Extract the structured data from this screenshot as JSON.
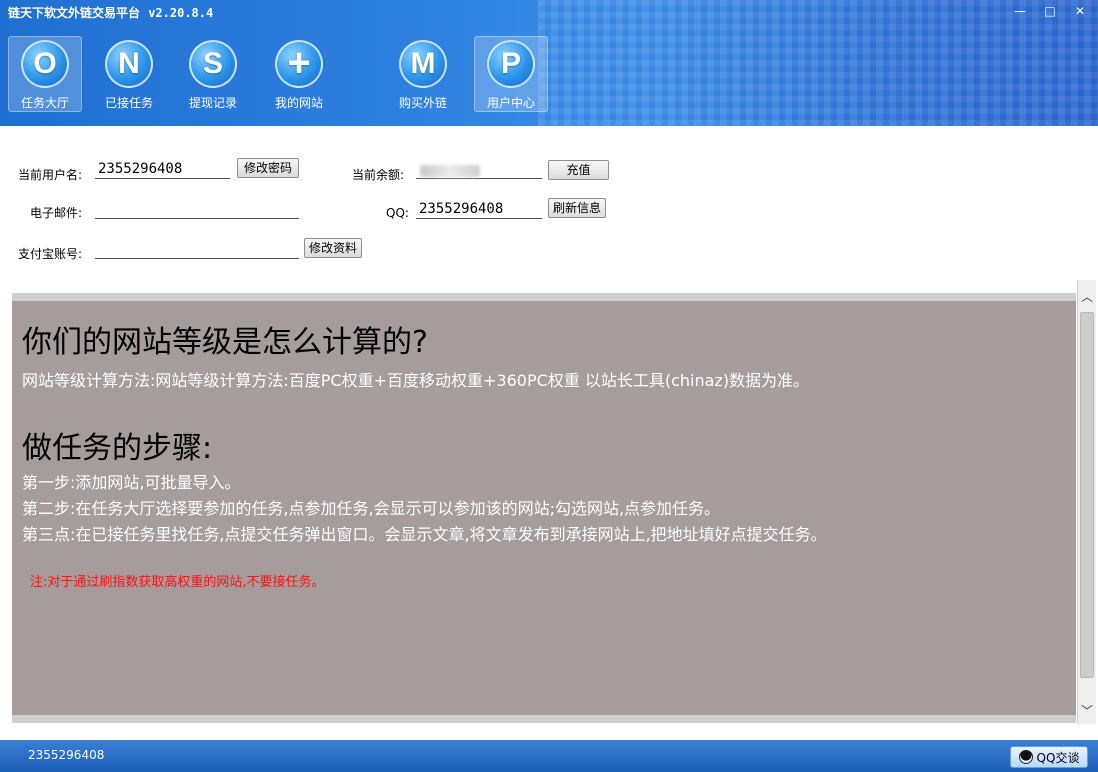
{
  "window": {
    "title": "链天下软文外链交易平台",
    "version": "v2.20.8.4",
    "controls": {
      "minimize": "—",
      "maximize": "□",
      "close": "✕"
    }
  },
  "toolbar": {
    "items": [
      {
        "letter": "O",
        "label": "任务大厅",
        "icon": "o-icon"
      },
      {
        "letter": "N",
        "label": "已接任务",
        "icon": "n-icon"
      },
      {
        "letter": "S",
        "label": "提现记录",
        "icon": "s-icon"
      },
      {
        "letter": "+",
        "label": "我的网站",
        "icon": "plus-icon"
      },
      {
        "letter": "M",
        "label": "购买外链",
        "icon": "m-icon"
      },
      {
        "letter": "P",
        "label": "用户中心",
        "icon": "p-icon"
      }
    ]
  },
  "form": {
    "username_label": "当前用户名:",
    "username_value": "2355296408",
    "change_password_button": "修改密码",
    "balance_label": "当前余额:",
    "recharge_button": "充值",
    "email_label": "电子邮件:",
    "email_value": "",
    "qq_label": "QQ:",
    "qq_value": "2355296408",
    "refresh_button": "刷新信息",
    "alipay_label": "支付宝账号:",
    "alipay_value": "",
    "edit_profile_button": "修改资料"
  },
  "content": {
    "heading1": "你们的网站等级是怎么计算的?",
    "para1": "网站等级计算方法:网站等级计算方法:百度PC权重+百度移动权重+360PC权重  以站长工具(chinaz)数据为准。",
    "heading2": "做任务的步骤:",
    "step1": "第一步:添加网站,可批量导入。",
    "step2": "第二步:在任务大厅选择要参加的任务,点参加任务,会显示可以参加该的网站;勾选网站,点参加任务。",
    "step3": "第三点:在已接任务里找任务,点提交任务弹出窗口。会显示文章,将文章发布到承接网站上,把地址填好点提交任务。",
    "note": "注:对于通过刷指数获取高权重的网站,不要接任务。"
  },
  "statusbar": {
    "user": "2355296408",
    "qq_button": "QQ交谈"
  },
  "colors": {
    "header_blue": "#2d7fe0",
    "panel_gray": "#a59c9b",
    "note_red": "#ff1010"
  }
}
